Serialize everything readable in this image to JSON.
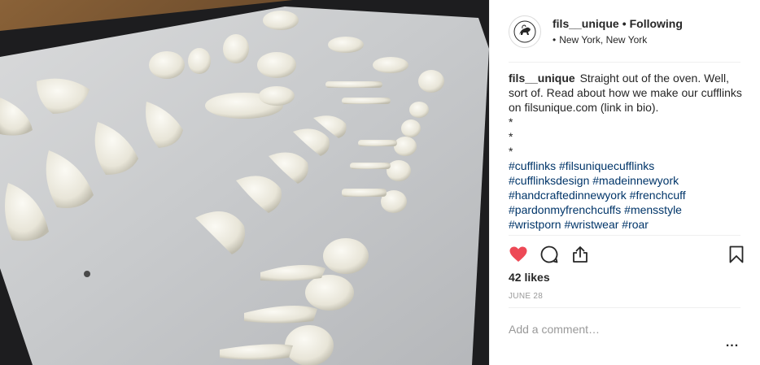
{
  "post": {
    "image_alt": "Cufflink castings on baking paper",
    "colors": {
      "link": "#003569",
      "like": "#ed4956",
      "muted": "#999999",
      "text": "#262626"
    }
  },
  "header": {
    "username": "fils__unique",
    "separator": "•",
    "follow_status": "Following",
    "location_pin": "•",
    "location": "New York, New York"
  },
  "caption": {
    "username": "fils__unique",
    "text": "Straight out of the oven. Well, sort of. Read about how we make our cufflinks on filsunique.com (link in bio).",
    "stars": [
      "*",
      "*",
      "*"
    ],
    "hashtags": [
      "#cufflinks",
      "#filsuniquecufflinks",
      "#cufflinksdesign",
      "#madeinnewyork",
      "#handcraftedinnewyork",
      "#frenchcuff",
      "#pardonmyfrenchcuffs",
      "#mensstyle",
      "#wristporn",
      "#wristwear",
      "#roar"
    ]
  },
  "actions": {
    "icons": [
      "heart-icon",
      "comment-icon",
      "share-icon",
      "bookmark-icon"
    ],
    "liked": true
  },
  "likes": "42 likes",
  "date": "JUNE 28",
  "comment": {
    "placeholder": "Add a comment…"
  },
  "more_label": "..."
}
